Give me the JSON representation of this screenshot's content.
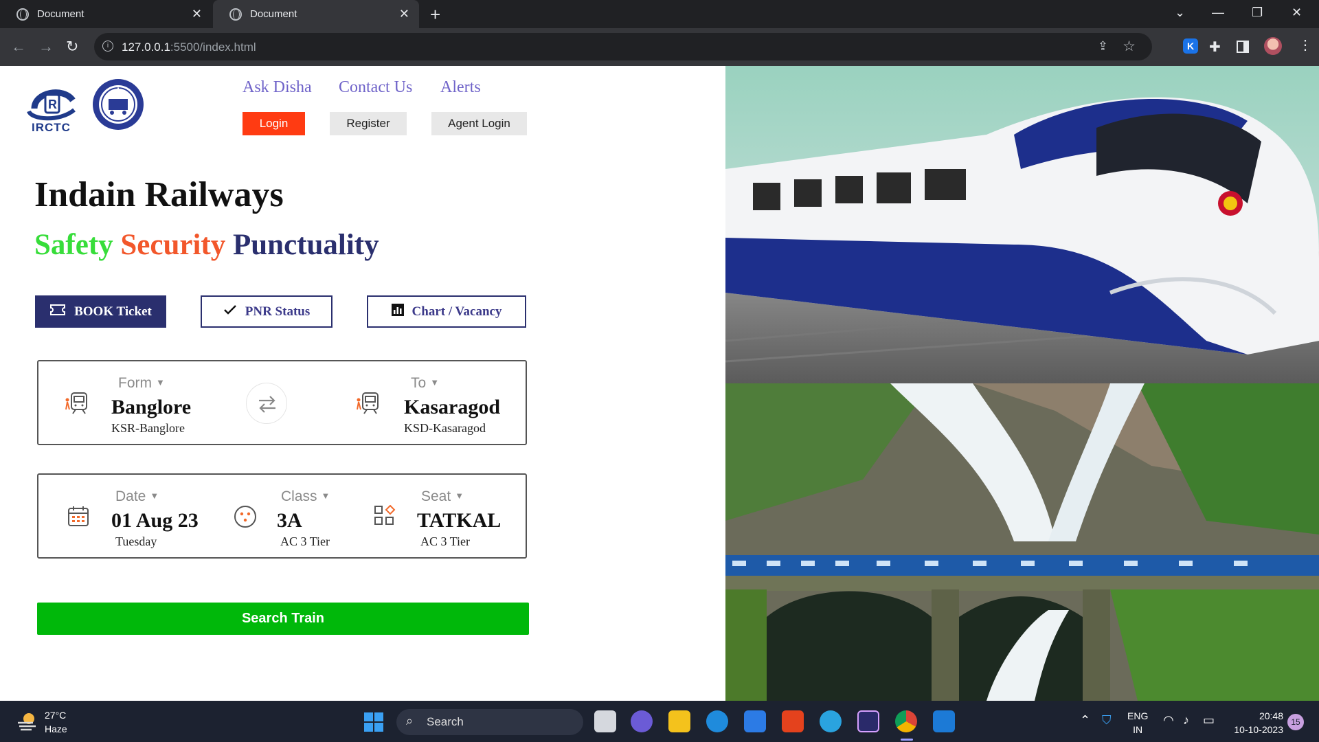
{
  "browser": {
    "tabs": [
      {
        "title": "Document",
        "close": "✕"
      },
      {
        "title": "Document",
        "close": "✕"
      }
    ],
    "new_tab": "+",
    "window": {
      "dropdown": "⌄",
      "minimize": "—",
      "restore": "❐",
      "close": "✕"
    },
    "nav": {
      "back": "←",
      "forward": "→",
      "reload": "↻"
    },
    "url_host": "127.0.0.1",
    "url_rest": ":5500/index.html",
    "extension_letter": "K"
  },
  "header": {
    "logo_text": "IRCTC",
    "links": [
      "Ask Disha",
      "Contact Us",
      "Alerts"
    ],
    "buttons": {
      "login": "Login",
      "register": "Register",
      "agent": "Agent Login"
    }
  },
  "hero": {
    "title": "Indain Railways",
    "tagline": [
      "Safety",
      "Security",
      "Punctuality"
    ]
  },
  "modes": {
    "book": "BOOK Ticket",
    "pnr": "PNR Status",
    "chart": "Chart / Vacancy"
  },
  "route": {
    "from": {
      "label": "Form",
      "city": "Banglore",
      "code": "KSR-Banglore"
    },
    "to": {
      "label": "To",
      "city": "Kasaragod",
      "code": "KSD-Kasaragod"
    }
  },
  "options": {
    "date": {
      "label": "Date",
      "value": "01 Aug 23",
      "sub": "Tuesday"
    },
    "class": {
      "label": "Class",
      "value": "3A",
      "sub": "AC 3 Tier"
    },
    "seat": {
      "label": "Seat",
      "value": "TATKAL",
      "sub": "AC 3 Tier"
    }
  },
  "search_button": "Search Train",
  "taskbar": {
    "weather_temp": "27°C",
    "weather_desc": "Haze",
    "search_label": "Search",
    "lang_1": "ENG",
    "lang_2": "IN",
    "time": "20:48",
    "date": "10-10-2023",
    "badge": "15"
  },
  "colors": {
    "accent_navy": "#2a2f6e",
    "login_red": "#ff3b12",
    "search_green": "#00b80a",
    "safety_green": "#37dd3a",
    "security_orange": "#f2572b"
  }
}
